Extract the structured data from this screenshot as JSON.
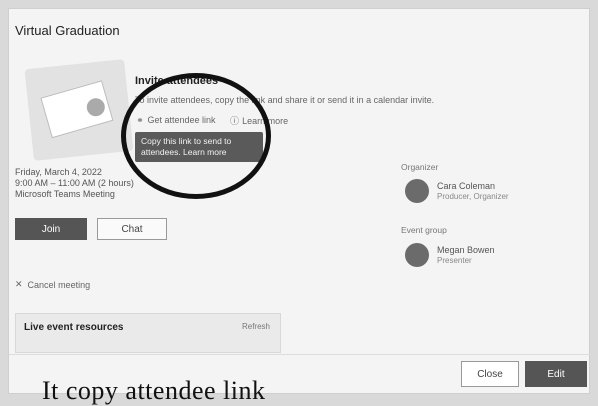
{
  "dialog": {
    "title": "Virtual Graduation"
  },
  "invite": {
    "title": "Invite attendees",
    "text": "To invite attendees, copy the link and share it or send it in a calendar invite.",
    "get_link": "Get attendee link",
    "learn_more": "Learn more",
    "tooltip": "Copy this link to send to attendees. Learn more"
  },
  "meeting": {
    "date": "Friday, March 4, 2022",
    "time": "9:00 AM – 11:00 AM (2 hours)",
    "type": "Microsoft Teams Meeting"
  },
  "buttons": {
    "join": "Join",
    "chat": "Chat",
    "close": "Close",
    "edit": "Edit"
  },
  "cancel": {
    "label": "Cancel meeting"
  },
  "resources": {
    "title": "Live event resources",
    "refresh": "Refresh"
  },
  "organizer": {
    "label": "Organizer",
    "name": "Cara Coleman",
    "role": "Producer, Organizer"
  },
  "event_group": {
    "label": "Event group",
    "name": "Megan Bowen",
    "role": "Presenter"
  },
  "caption": "It copy attendee link",
  "icons": {
    "link": "link-icon",
    "info": "info-icon",
    "cancel": "close-icon"
  }
}
